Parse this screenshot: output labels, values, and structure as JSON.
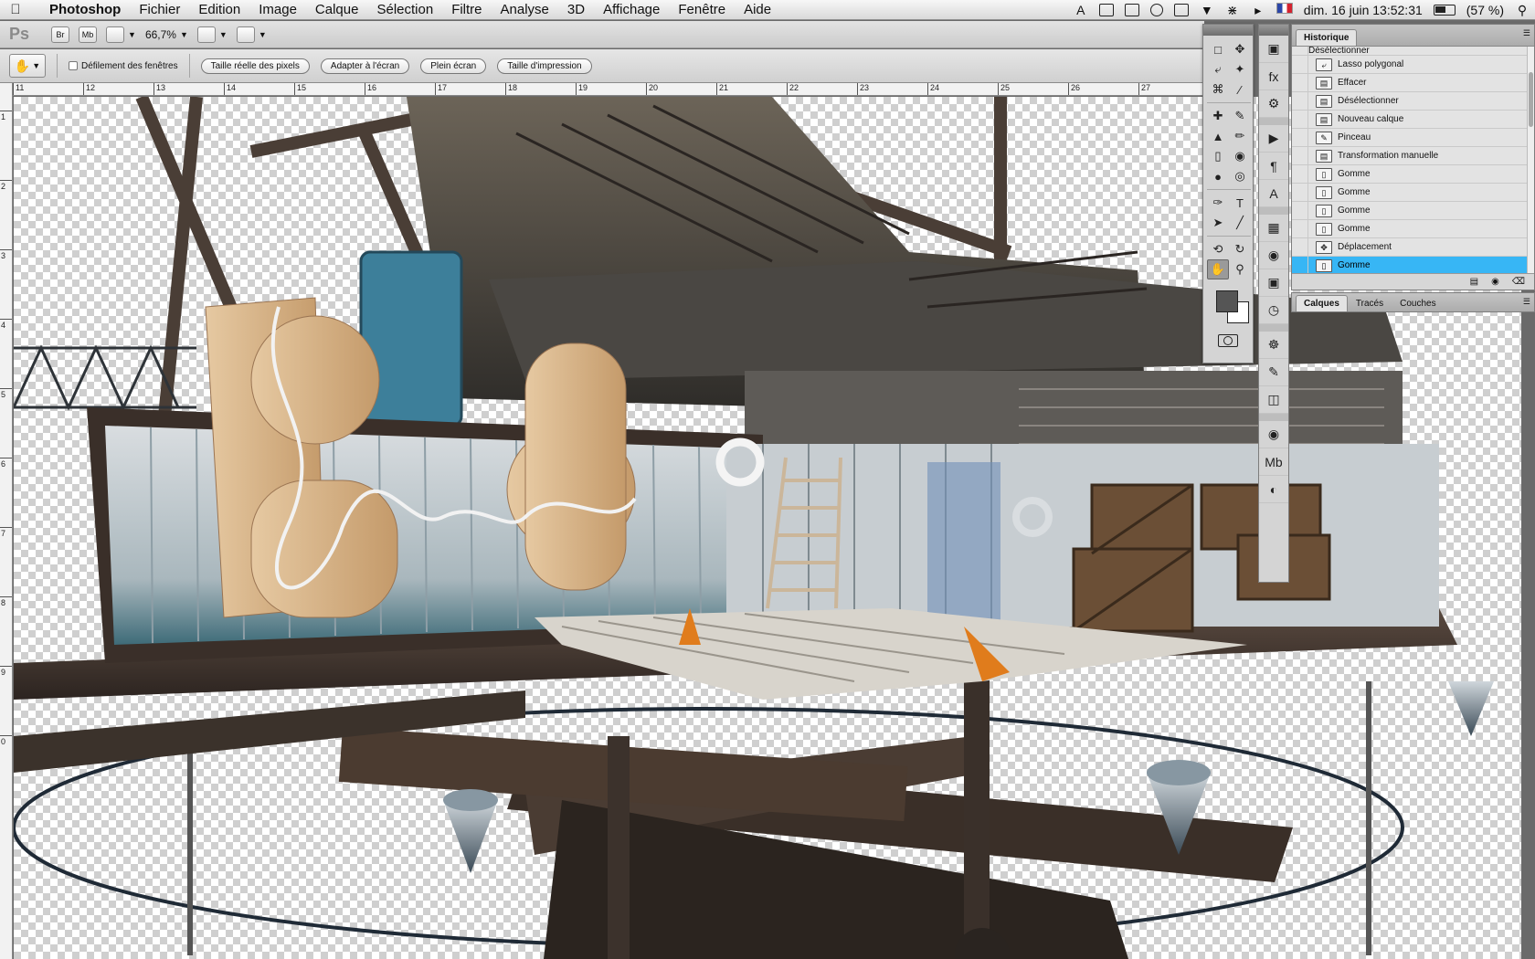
{
  "menubar": {
    "app_name": "Photoshop",
    "items": [
      "Fichier",
      "Edition",
      "Image",
      "Calque",
      "Sélection",
      "Filtre",
      "Analyse",
      "3D",
      "Affichage",
      "Fenêtre",
      "Aide"
    ],
    "status": {
      "flag_number": "123",
      "datetime": "dim. 16 juin  13:52:31",
      "battery": "(57 %)"
    }
  },
  "appbar": {
    "logo": "Ps",
    "bridge": "Br",
    "mini_bridge": "Mb",
    "zoom": "66,7%"
  },
  "options": {
    "scroll_all_windows": "Défilement des fenêtres",
    "actual_pixels": "Taille réelle des pixels",
    "fit_screen": "Adapter à l'écran",
    "full_screen": "Plein écran",
    "print_size": "Taille d'impression"
  },
  "ruler": {
    "top": [
      "11",
      "12",
      "13",
      "14",
      "15",
      "16",
      "17",
      "18",
      "19",
      "20",
      "21",
      "22",
      "23",
      "24",
      "25",
      "26",
      "27"
    ],
    "left": [
      "1",
      "2",
      "3",
      "4",
      "5",
      "6",
      "7",
      "8",
      "9",
      "0"
    ]
  },
  "history": {
    "tab_label": "Historique",
    "partial_item": "Désélectionner",
    "items": [
      {
        "label": "Lasso polygonal",
        "icon": "lasso-icon"
      },
      {
        "label": "Effacer",
        "icon": "document-icon"
      },
      {
        "label": "Désélectionner",
        "icon": "document-icon"
      },
      {
        "label": "Nouveau calque",
        "icon": "document-icon"
      },
      {
        "label": "Pinceau",
        "icon": "brush-icon"
      },
      {
        "label": "Transformation manuelle",
        "icon": "document-icon"
      },
      {
        "label": "Gomme",
        "icon": "eraser-icon"
      },
      {
        "label": "Gomme",
        "icon": "eraser-icon"
      },
      {
        "label": "Gomme",
        "icon": "eraser-icon"
      },
      {
        "label": "Gomme",
        "icon": "eraser-icon"
      },
      {
        "label": "Déplacement",
        "icon": "move-icon"
      },
      {
        "label": "Gomme",
        "icon": "eraser-icon",
        "active": true
      }
    ],
    "active_color": "#37b6f5"
  },
  "layers_panel": {
    "tabs": [
      "Calques",
      "Tracés",
      "Couches"
    ]
  },
  "colors": {
    "foreground": "#555555",
    "background": "#ffffff"
  }
}
